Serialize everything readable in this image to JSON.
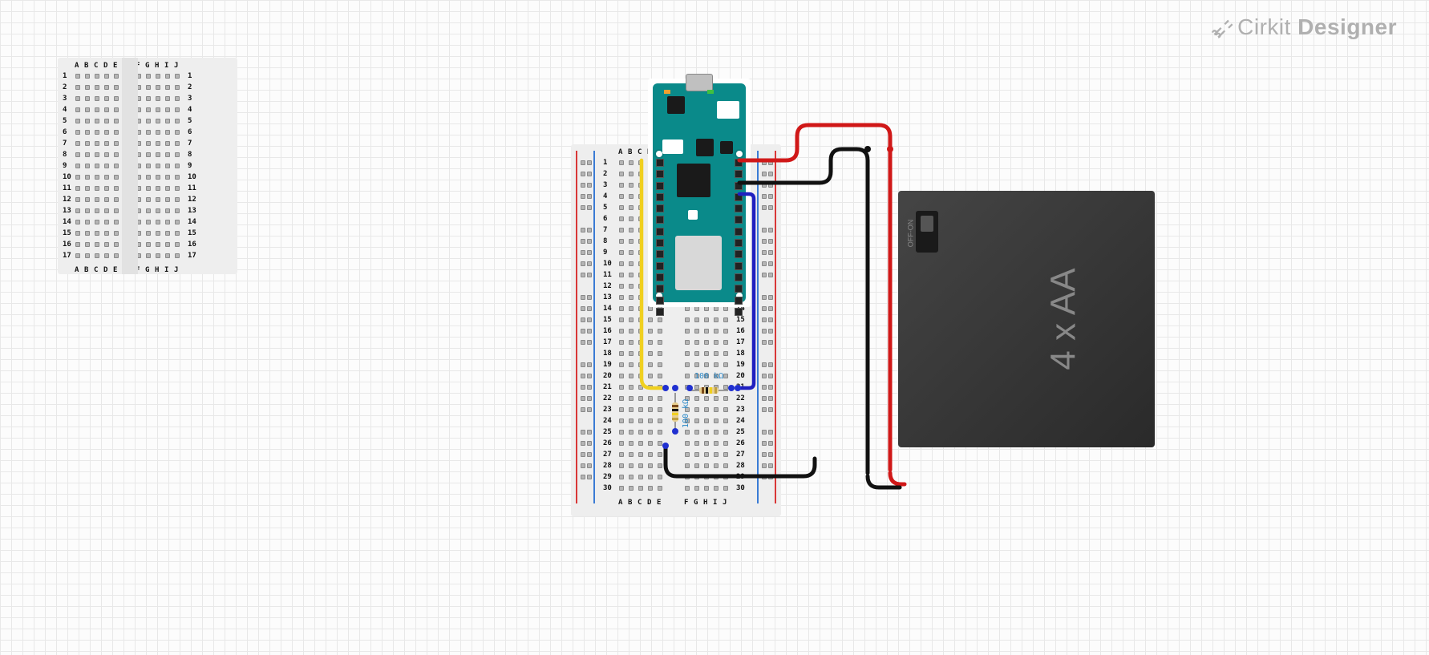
{
  "logo": {
    "brand": "Cirkit",
    "product": "Designer"
  },
  "breadboards": {
    "small": {
      "columns": [
        "A",
        "B",
        "C",
        "D",
        "E",
        "F",
        "G",
        "H",
        "I",
        "J"
      ],
      "rows": [
        1,
        2,
        3,
        4,
        5,
        6,
        7,
        8,
        9,
        10,
        11,
        12,
        13,
        14,
        15,
        16,
        17
      ]
    },
    "large": {
      "columns": [
        "A",
        "B",
        "C",
        "D",
        "E",
        "F",
        "G",
        "H",
        "I",
        "J"
      ],
      "rows": [
        1,
        2,
        3,
        4,
        5,
        6,
        7,
        8,
        9,
        10,
        11,
        12,
        13,
        14,
        15,
        16,
        17,
        18,
        19,
        20,
        21,
        22,
        23,
        24,
        25,
        26,
        27,
        28,
        29,
        30
      ]
    }
  },
  "components": {
    "arduino": {
      "name": "Arduino MKR"
    },
    "battery": {
      "label": "4 x AA",
      "switch": "OFF-ON"
    },
    "resistors": [
      {
        "value": "100 kΩ",
        "orientation": "horizontal"
      },
      {
        "value": "100 kΩ",
        "orientation": "vertical"
      }
    ]
  },
  "wires": [
    {
      "color": "red",
      "from": "arduino VIN J1",
      "to": "battery +"
    },
    {
      "color": "black",
      "from": "arduino GND J3",
      "to": "battery -"
    },
    {
      "color": "black",
      "from": "battery -",
      "to": "breadboard GND rail"
    },
    {
      "color": "red",
      "from": "battery +",
      "to": "breadboard 5V rail"
    },
    {
      "color": "yellow",
      "from": "breadboard A1",
      "to": "breadboard C21"
    },
    {
      "color": "blue",
      "from": "arduino pin",
      "to": "breadboard I21"
    },
    {
      "color": "black",
      "from": "breadboard C26",
      "to": "GND rail row28"
    }
  ]
}
